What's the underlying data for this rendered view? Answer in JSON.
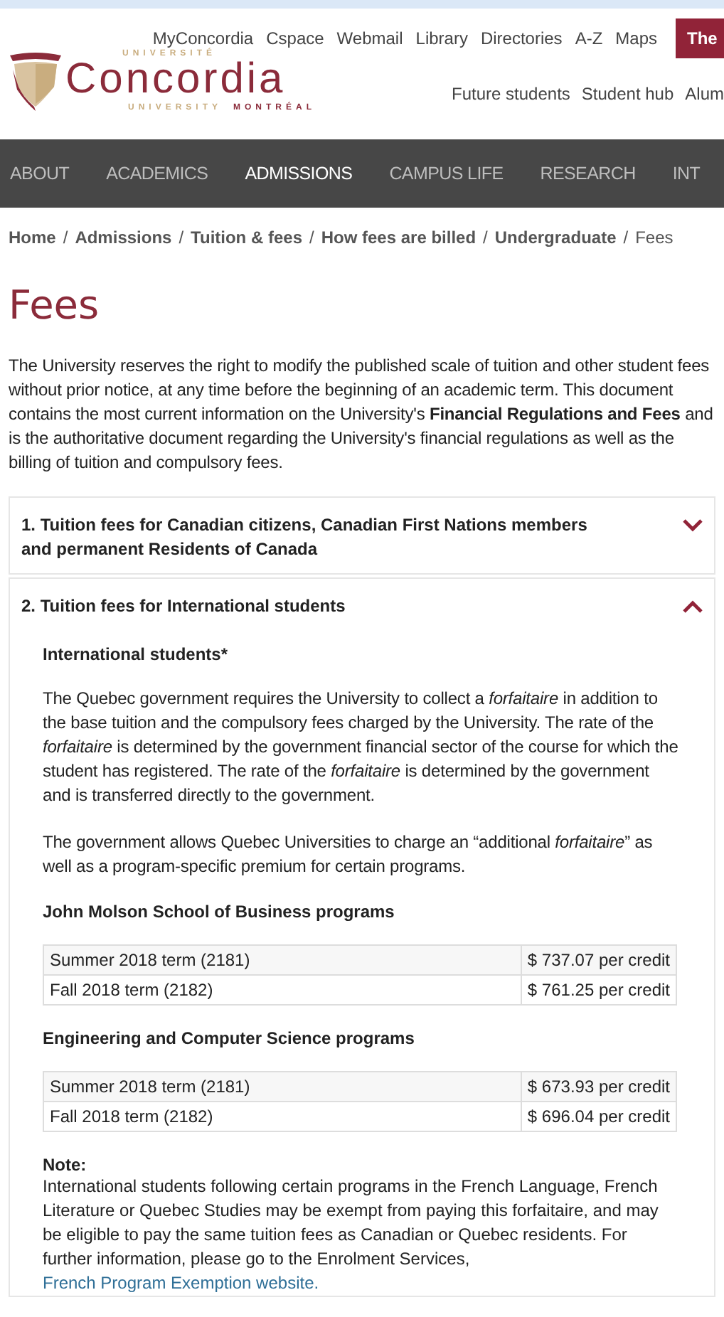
{
  "utility_links": [
    "MyConcordia",
    "Cspace",
    "Webmail",
    "Library",
    "Directories",
    "A-Z",
    "Maps"
  ],
  "utility_button": "The",
  "logo": {
    "top": "UNIVERSITÉ",
    "name": "Concordia",
    "bottom": "UNIVERSITY",
    "city": "MONTRÉAL"
  },
  "audience_links": [
    "Future students",
    "Student hub",
    "Alum"
  ],
  "nav": [
    {
      "label": "ABOUT",
      "selected": false
    },
    {
      "label": "ACADEMICS",
      "selected": false
    },
    {
      "label": "ADMISSIONS",
      "selected": true
    },
    {
      "label": "CAMPUS LIFE",
      "selected": false
    },
    {
      "label": "RESEARCH",
      "selected": false
    },
    {
      "label": "INT",
      "selected": false
    }
  ],
  "breadcrumb_separator": "/",
  "breadcrumb": [
    "Home",
    "Admissions",
    "Tuition & fees",
    "How fees are billed",
    "Undergraduate",
    "Fees"
  ],
  "title": "Fees",
  "intro": "The University reserves the right to modify the published scale of tuition and other student fees without prior notice, at any time before the beginning of an academic term. This document contains the most current information on the University's **Financial Regulations and Fees** and is the authoritative document regarding the University's financial regulations as well as the billing of tuition and compulsory fees.",
  "accordion": [
    {
      "title": "1. Tuition fees for Canadian citizens, Canadian First Nations members and permanent Residents of Canada",
      "expanded": false
    },
    {
      "title": "2. Tuition fees for International students",
      "expanded": true,
      "content": [
        {
          "kind": "heading",
          "text": "International students*"
        },
        {
          "kind": "paragraph",
          "text": "The Quebec government requires the University to collect a *forfaitaire* in addition to the base tuition and the compulsory fees charged by the University. The rate of the *forfaitaire* is determined by the government financial sector of the course for which the student has registered. The rate of the *forfaitaire* is determined by the government and is transferred directly to the government."
        },
        {
          "kind": "paragraph",
          "text": "The government allows Quebec Universities to charge an “additional *forfaitaire*” as well as a program-specific premium for certain programs."
        },
        {
          "kind": "heading",
          "text": "John Molson School of Business programs"
        },
        {
          "kind": "table",
          "rows": [
            [
              "Summer 2018 term (2181)",
              "$ 737.07 per credit"
            ],
            [
              "Fall 2018 term (2182)",
              "$ 761.25 per credit"
            ]
          ]
        },
        {
          "kind": "heading",
          "text": "Engineering and Computer Science programs"
        },
        {
          "kind": "table",
          "rows": [
            [
              "Summer 2018 term (2181)",
              "$ 673.93 per credit"
            ],
            [
              "Fall 2018 term (2182)",
              "$ 696.04 per credit"
            ]
          ]
        },
        {
          "kind": "note",
          "label": "Note:",
          "text": "International students following certain programs in the French Language, French Literature or Quebec Studies may be exempt from paying this forfaitaire, and may be eligible to pay the same tuition fees as Canadian or Quebec residents. For further information, please go to the Enrolment Services,",
          "link": "French Program Exemption website."
        }
      ]
    }
  ]
}
